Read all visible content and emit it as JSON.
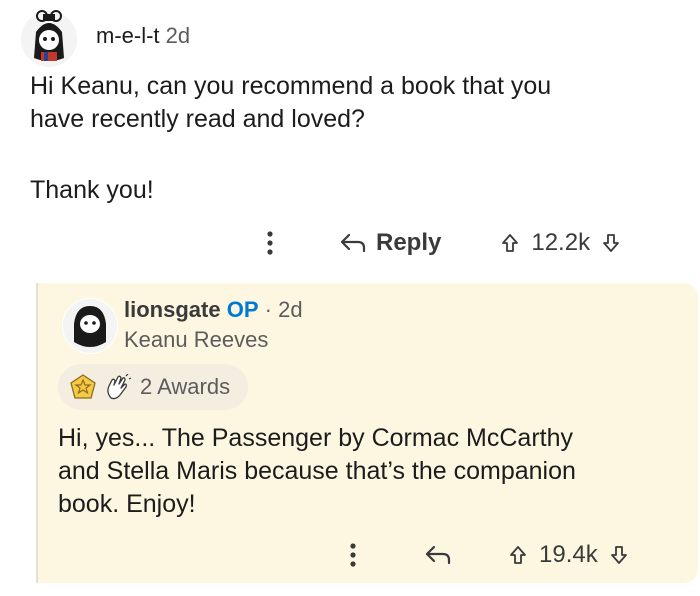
{
  "top_comment": {
    "username": "m-e-l-t",
    "age": "2d",
    "body_line1": "Hi Keanu, can you recommend a book that you",
    "body_line2": "have recently read and loved?",
    "body_line3": "Thank you!",
    "reply_label": "Reply",
    "score": "12.2k",
    "avatar_icon": "anime-girl-avatar-icon"
  },
  "reply_comment": {
    "username": "lionsgate",
    "op_badge": "OP",
    "separator": "·",
    "age": "2d",
    "flair": "Keanu Reeves",
    "awards_label": "2 Awards",
    "body_line1": "Hi, yes... The Passenger by Cormac McCarthy",
    "body_line2": "and Stella Maris because that’s the companion",
    "body_line3": "book. Enjoy!",
    "score": "19.4k",
    "avatar_icon": "bearded-man-avatar-icon"
  },
  "colors": {
    "reply_background": "#fdf7e2",
    "op_blue": "#0079d3",
    "award_pill": "#f3eee0"
  }
}
